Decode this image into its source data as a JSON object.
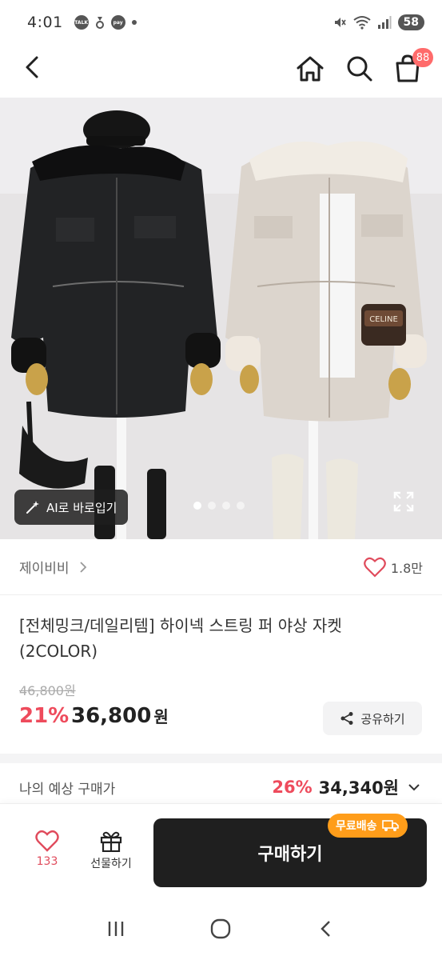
{
  "status_bar": {
    "time": "4:01",
    "battery": "58"
  },
  "header": {
    "cart_count": "88"
  },
  "gallery": {
    "ai_button_label": "AI로 바로입기",
    "page_count": 4,
    "active_page": 1,
    "bag_logo_text": "CELINE"
  },
  "shop": {
    "name": "제이비비",
    "likes": "1.8만"
  },
  "product": {
    "title": "[전체밍크/데일리템] 하이넥 스트링 퍼 야상 자켓 (2COLOR)",
    "original_price": "46,800원",
    "discount_rate": "21%",
    "sale_price": "36,800",
    "currency": "원",
    "share_label": "공유하기"
  },
  "expected": {
    "label": "나의 예상 구매가",
    "rate": "26%",
    "price": "34,340원"
  },
  "bottom_bar": {
    "wish_count": "133",
    "gift_label": "선물하기",
    "buy_label": "구매하기",
    "free_shipping_label": "무료배송"
  },
  "colors": {
    "accent": "#ee4b5c",
    "buy_button": "#1f1f1f",
    "shipping_badge": "#ff9d1a",
    "cart_badge": "#ff6b6b"
  }
}
